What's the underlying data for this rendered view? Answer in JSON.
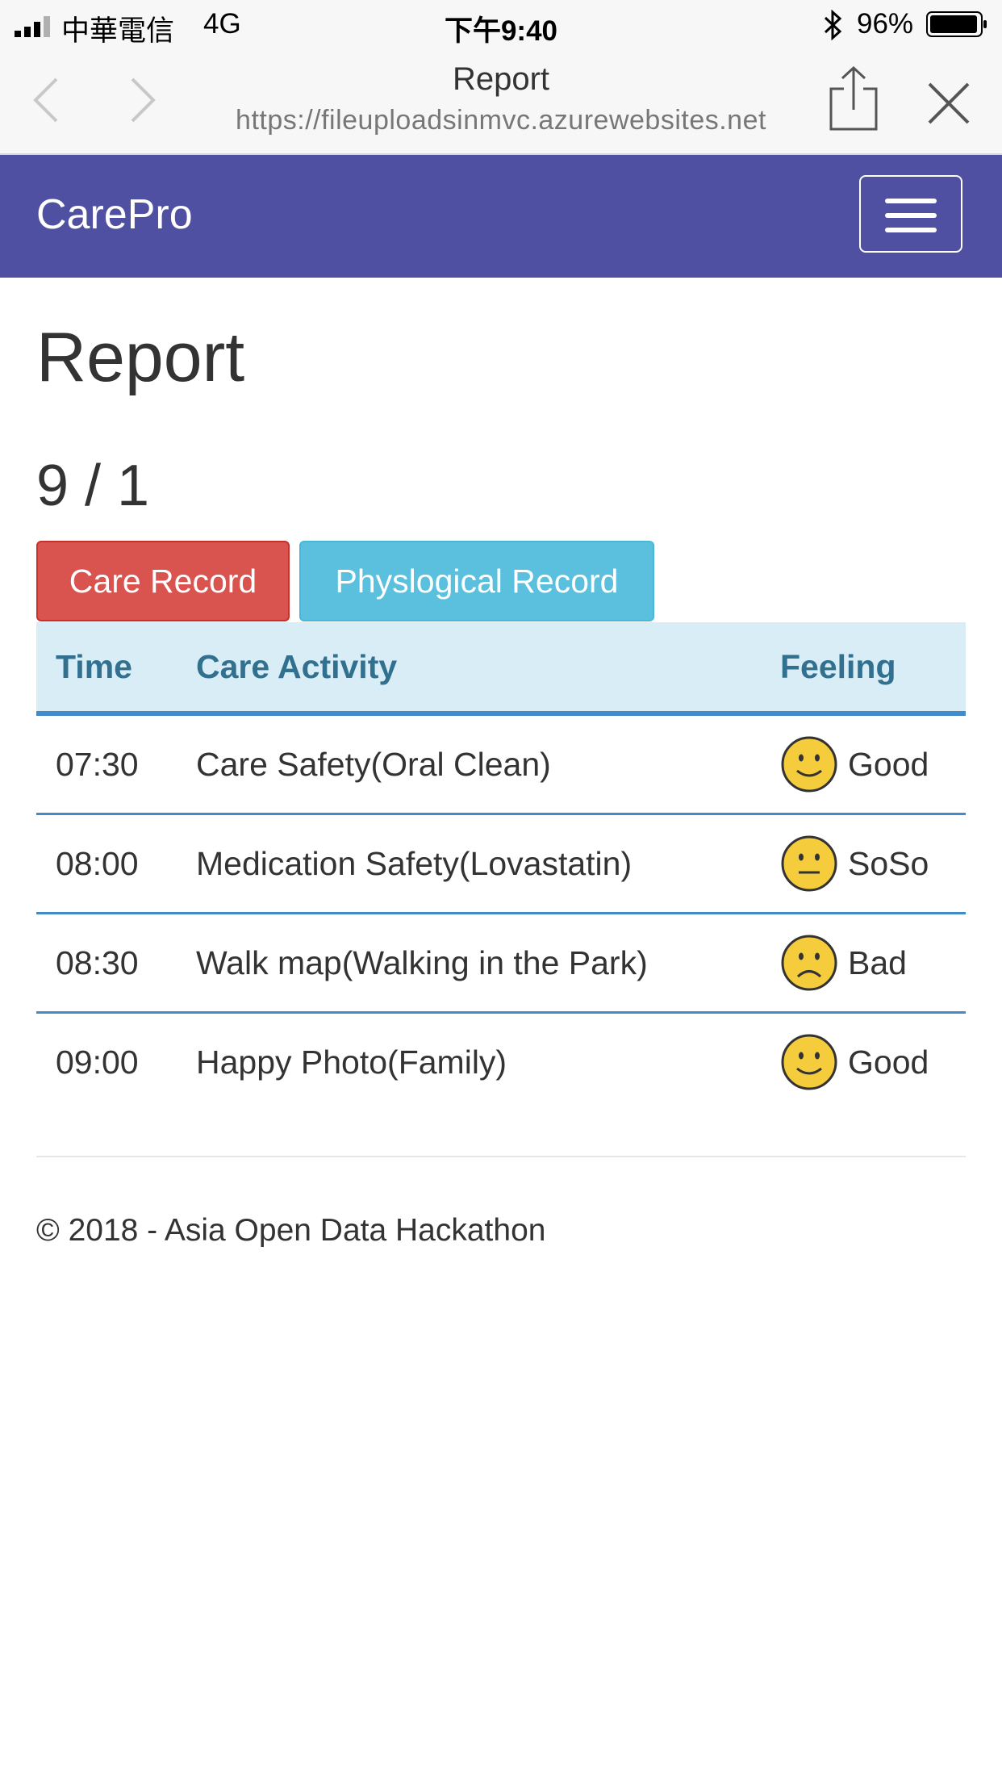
{
  "status_bar": {
    "carrier": "中華電信",
    "network": "4G",
    "time": "下午9:40",
    "battery": "96%"
  },
  "browser": {
    "title": "Report",
    "url": "https://fileuploadsinmvc.azurewebsites.net"
  },
  "navbar": {
    "brand": "CarePro"
  },
  "page": {
    "heading": "Report",
    "date": "9 / 1"
  },
  "buttons": {
    "care_record": "Care Record",
    "physlogical_record": "Physlogical Record"
  },
  "colors": {
    "navbar": "#5050a2",
    "care_button": "#d9534f",
    "phys_button": "#5bc0de",
    "table_header_bg": "#d9edf7",
    "table_header_text": "#31708f",
    "row_border": "#428bca",
    "face_fill": "#f4cc3c"
  },
  "table": {
    "headers": [
      "Time",
      "Care Activity",
      "Feeling"
    ],
    "rows": [
      {
        "time": "07:30",
        "activity": "Care Safety(Oral Clean)",
        "feeling": "Good",
        "icon": "smile-face-icon"
      },
      {
        "time": "08:00",
        "activity": "Medication Safety(Lovastatin)",
        "feeling": "SoSo",
        "icon": "neutral-face-icon"
      },
      {
        "time": "08:30",
        "activity": "Walk map(Walking in the Park)",
        "feeling": "Bad",
        "icon": "sad-face-icon"
      },
      {
        "time": "09:00",
        "activity": "Happy Photo(Family)",
        "feeling": "Good",
        "icon": "smile-face-icon"
      }
    ]
  },
  "footer": {
    "text": "© 2018 - Asia Open Data Hackathon"
  }
}
